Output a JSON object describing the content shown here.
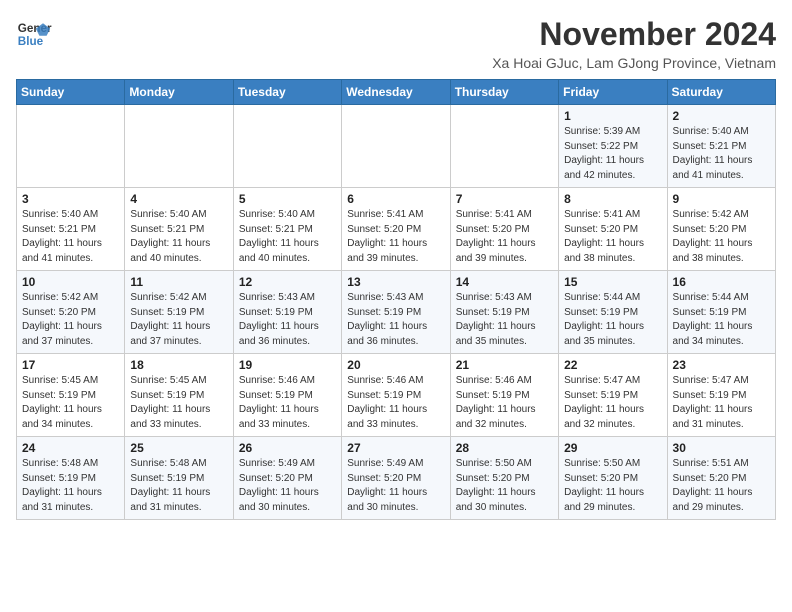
{
  "header": {
    "logo_line1": "General",
    "logo_line2": "Blue",
    "month_title": "November 2024",
    "subtitle": "Xa Hoai GJuc, Lam GJong Province, Vietnam"
  },
  "columns": [
    "Sunday",
    "Monday",
    "Tuesday",
    "Wednesday",
    "Thursday",
    "Friday",
    "Saturday"
  ],
  "weeks": [
    [
      {
        "day": "",
        "info": ""
      },
      {
        "day": "",
        "info": ""
      },
      {
        "day": "",
        "info": ""
      },
      {
        "day": "",
        "info": ""
      },
      {
        "day": "",
        "info": ""
      },
      {
        "day": "1",
        "info": "Sunrise: 5:39 AM\nSunset: 5:22 PM\nDaylight: 11 hours\nand 42 minutes."
      },
      {
        "day": "2",
        "info": "Sunrise: 5:40 AM\nSunset: 5:21 PM\nDaylight: 11 hours\nand 41 minutes."
      }
    ],
    [
      {
        "day": "3",
        "info": "Sunrise: 5:40 AM\nSunset: 5:21 PM\nDaylight: 11 hours\nand 41 minutes."
      },
      {
        "day": "4",
        "info": "Sunrise: 5:40 AM\nSunset: 5:21 PM\nDaylight: 11 hours\nand 40 minutes."
      },
      {
        "day": "5",
        "info": "Sunrise: 5:40 AM\nSunset: 5:21 PM\nDaylight: 11 hours\nand 40 minutes."
      },
      {
        "day": "6",
        "info": "Sunrise: 5:41 AM\nSunset: 5:20 PM\nDaylight: 11 hours\nand 39 minutes."
      },
      {
        "day": "7",
        "info": "Sunrise: 5:41 AM\nSunset: 5:20 PM\nDaylight: 11 hours\nand 39 minutes."
      },
      {
        "day": "8",
        "info": "Sunrise: 5:41 AM\nSunset: 5:20 PM\nDaylight: 11 hours\nand 38 minutes."
      },
      {
        "day": "9",
        "info": "Sunrise: 5:42 AM\nSunset: 5:20 PM\nDaylight: 11 hours\nand 38 minutes."
      }
    ],
    [
      {
        "day": "10",
        "info": "Sunrise: 5:42 AM\nSunset: 5:20 PM\nDaylight: 11 hours\nand 37 minutes."
      },
      {
        "day": "11",
        "info": "Sunrise: 5:42 AM\nSunset: 5:19 PM\nDaylight: 11 hours\nand 37 minutes."
      },
      {
        "day": "12",
        "info": "Sunrise: 5:43 AM\nSunset: 5:19 PM\nDaylight: 11 hours\nand 36 minutes."
      },
      {
        "day": "13",
        "info": "Sunrise: 5:43 AM\nSunset: 5:19 PM\nDaylight: 11 hours\nand 36 minutes."
      },
      {
        "day": "14",
        "info": "Sunrise: 5:43 AM\nSunset: 5:19 PM\nDaylight: 11 hours\nand 35 minutes."
      },
      {
        "day": "15",
        "info": "Sunrise: 5:44 AM\nSunset: 5:19 PM\nDaylight: 11 hours\nand 35 minutes."
      },
      {
        "day": "16",
        "info": "Sunrise: 5:44 AM\nSunset: 5:19 PM\nDaylight: 11 hours\nand 34 minutes."
      }
    ],
    [
      {
        "day": "17",
        "info": "Sunrise: 5:45 AM\nSunset: 5:19 PM\nDaylight: 11 hours\nand 34 minutes."
      },
      {
        "day": "18",
        "info": "Sunrise: 5:45 AM\nSunset: 5:19 PM\nDaylight: 11 hours\nand 33 minutes."
      },
      {
        "day": "19",
        "info": "Sunrise: 5:46 AM\nSunset: 5:19 PM\nDaylight: 11 hours\nand 33 minutes."
      },
      {
        "day": "20",
        "info": "Sunrise: 5:46 AM\nSunset: 5:19 PM\nDaylight: 11 hours\nand 33 minutes."
      },
      {
        "day": "21",
        "info": "Sunrise: 5:46 AM\nSunset: 5:19 PM\nDaylight: 11 hours\nand 32 minutes."
      },
      {
        "day": "22",
        "info": "Sunrise: 5:47 AM\nSunset: 5:19 PM\nDaylight: 11 hours\nand 32 minutes."
      },
      {
        "day": "23",
        "info": "Sunrise: 5:47 AM\nSunset: 5:19 PM\nDaylight: 11 hours\nand 31 minutes."
      }
    ],
    [
      {
        "day": "24",
        "info": "Sunrise: 5:48 AM\nSunset: 5:19 PM\nDaylight: 11 hours\nand 31 minutes."
      },
      {
        "day": "25",
        "info": "Sunrise: 5:48 AM\nSunset: 5:19 PM\nDaylight: 11 hours\nand 31 minutes."
      },
      {
        "day": "26",
        "info": "Sunrise: 5:49 AM\nSunset: 5:20 PM\nDaylight: 11 hours\nand 30 minutes."
      },
      {
        "day": "27",
        "info": "Sunrise: 5:49 AM\nSunset: 5:20 PM\nDaylight: 11 hours\nand 30 minutes."
      },
      {
        "day": "28",
        "info": "Sunrise: 5:50 AM\nSunset: 5:20 PM\nDaylight: 11 hours\nand 30 minutes."
      },
      {
        "day": "29",
        "info": "Sunrise: 5:50 AM\nSunset: 5:20 PM\nDaylight: 11 hours\nand 29 minutes."
      },
      {
        "day": "30",
        "info": "Sunrise: 5:51 AM\nSunset: 5:20 PM\nDaylight: 11 hours\nand 29 minutes."
      }
    ]
  ]
}
